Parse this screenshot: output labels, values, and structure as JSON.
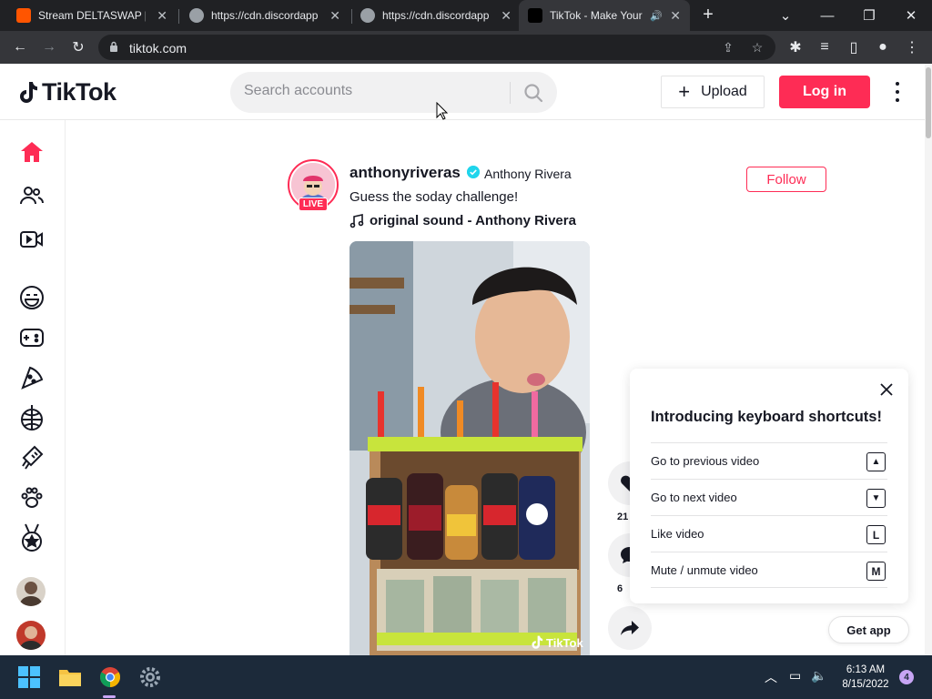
{
  "browser": {
    "tabs": [
      {
        "title": "Stream DELTASWAP [Cl",
        "active": false
      },
      {
        "title": "https://cdn.discordapp",
        "active": false
      },
      {
        "title": "https://cdn.discordapp",
        "active": false
      },
      {
        "title": "TikTok - Make Your",
        "active": true
      }
    ],
    "url": "tiktok.com"
  },
  "header": {
    "logo_text": "TikTok",
    "search_placeholder": "Search accounts",
    "upload_label": "Upload",
    "login_label": "Log in"
  },
  "post": {
    "username": "anthonyriveras",
    "display_name": "Anthony Rivera",
    "live_label": "LIVE",
    "caption": "Guess the soday challenge!",
    "sound": "original sound - Anthony Rivera",
    "follow_label": "Follow",
    "watermark": "TikTok",
    "like_count": "21",
    "comment_count": "6"
  },
  "shortcuts": {
    "title": "Introducing keyboard shortcuts!",
    "items": [
      {
        "label": "Go to previous video",
        "key": "▲"
      },
      {
        "label": "Go to next video",
        "key": "▼"
      },
      {
        "label": "Like video",
        "key": "L"
      },
      {
        "label": "Mute / unmute video",
        "key": "M"
      }
    ]
  },
  "get_app_label": "Get app",
  "taskbar": {
    "time": "6:13 AM",
    "date": "8/15/2022",
    "notifications": "4"
  },
  "colors": {
    "brand": "#fe2c55",
    "chrome_dark": "#202124",
    "chrome_toolbar": "#35363a"
  }
}
